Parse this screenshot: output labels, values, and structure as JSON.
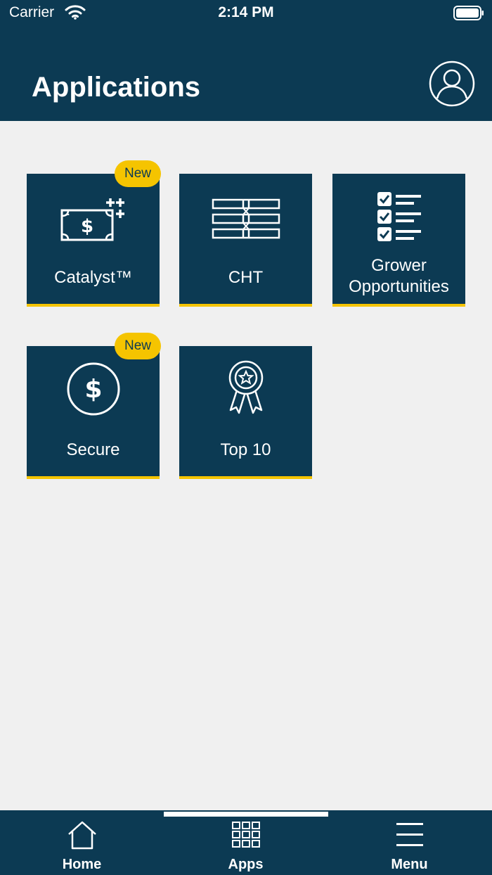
{
  "status_bar": {
    "carrier": "Carrier",
    "time": "2:14 PM"
  },
  "header": {
    "title": "Applications",
    "profile_icon": "user-circle-icon"
  },
  "apps": [
    {
      "label": "Catalyst™",
      "badge": "New",
      "icon": "money-plus-icon"
    },
    {
      "label": "CHT",
      "badge": "",
      "icon": "table-grid-icon"
    },
    {
      "label_line1": "Grower",
      "label_line2": "Opportunities",
      "badge": "",
      "icon": "checklist-icon"
    },
    {
      "label": "Secure",
      "badge": "New",
      "icon": "dollar-circle-icon"
    },
    {
      "label": "Top 10",
      "badge": "",
      "icon": "award-ribbon-icon"
    }
  ],
  "bottom_nav": {
    "items": [
      {
        "label": "Home",
        "icon": "home-icon"
      },
      {
        "label": "Apps",
        "icon": "apps-grid-icon",
        "active": true
      },
      {
        "label": "Menu",
        "icon": "hamburger-menu-icon"
      }
    ]
  },
  "colors": {
    "primary": "#0c3a53",
    "accent": "#f5c400",
    "background": "#f0f0f0",
    "text_light": "#ffffff"
  }
}
